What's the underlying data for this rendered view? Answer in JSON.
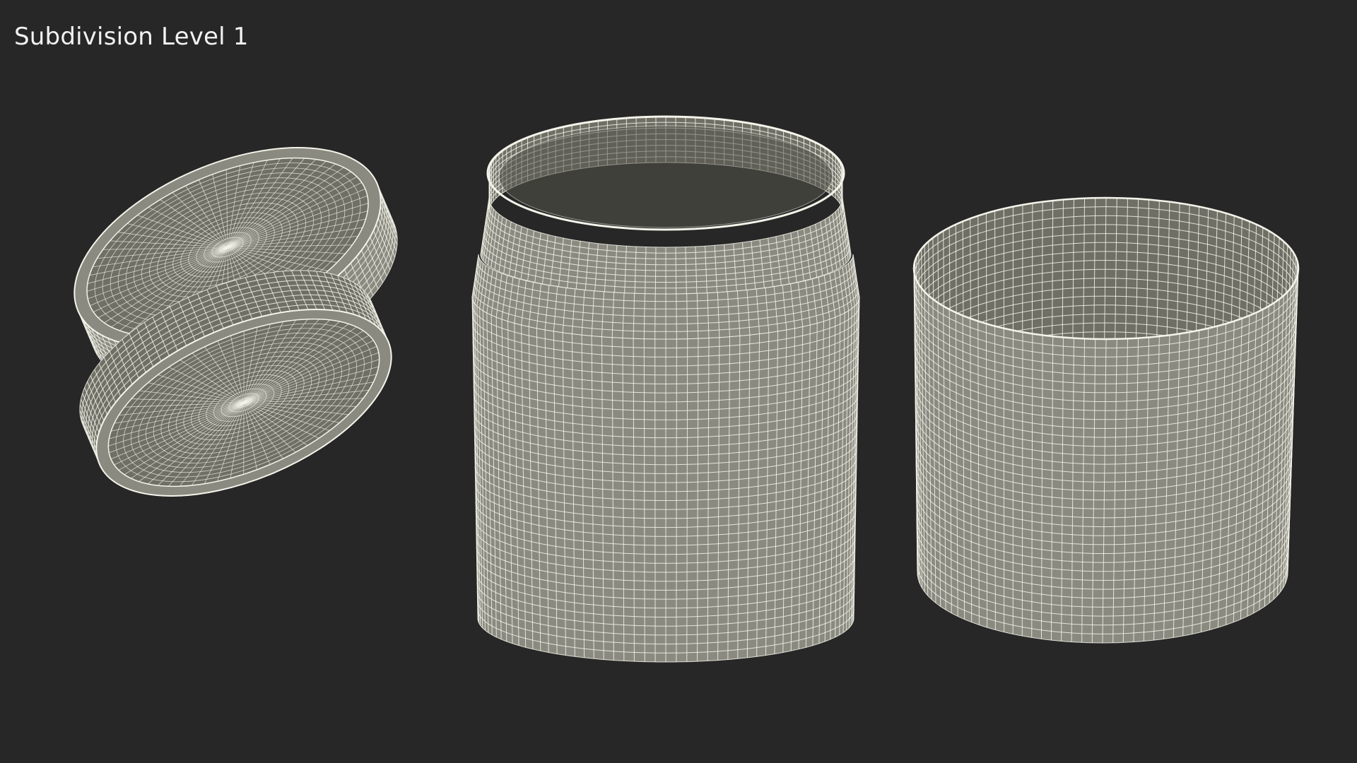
{
  "render": {
    "caption": "Subdivision Level 1",
    "colors": {
      "background": "#272727",
      "mesh_fill": "#8a8a80",
      "mesh_fill_dark": "#55554d",
      "mesh_inner": "#6f6f66",
      "wire": "#f4f4ea",
      "caption_text": "#f2f2f2"
    }
  },
  "objects": [
    {
      "name": "lid-top",
      "kind": "wireframe lid"
    },
    {
      "name": "lid-bottom",
      "kind": "wireframe lid"
    },
    {
      "name": "jar",
      "kind": "wireframe jar"
    },
    {
      "name": "label-sleeve",
      "kind": "wireframe cylinder"
    }
  ]
}
